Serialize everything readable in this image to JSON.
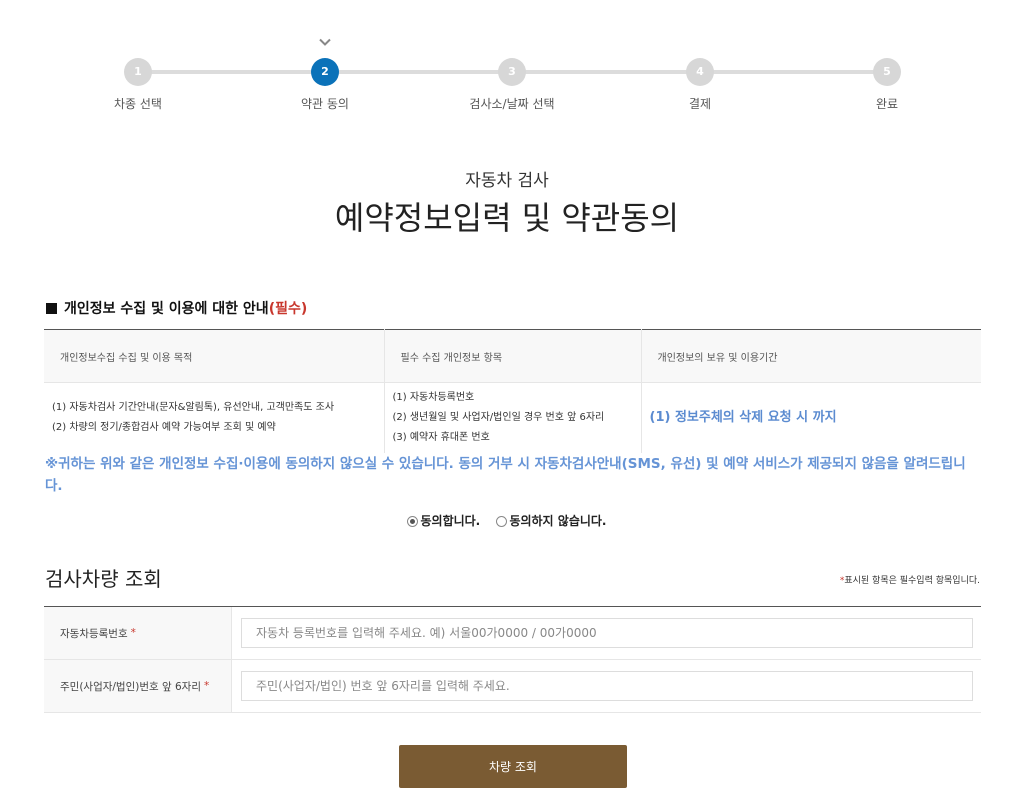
{
  "steps": [
    {
      "num": "1",
      "label": "차종 선택"
    },
    {
      "num": "2",
      "label": "약관 동의"
    },
    {
      "num": "3",
      "label": "검사소/날짜 선택"
    },
    {
      "num": "4",
      "label": "결제"
    },
    {
      "num": "5",
      "label": "완료"
    }
  ],
  "active_step": "2",
  "header": {
    "subtitle": "자동차 검사",
    "title": "예약정보입력 및 약관동의"
  },
  "privacy": {
    "heading": "개인정보 수집 및 이용에 대한 안내",
    "required": "(필수)",
    "columns": [
      "개인정보수집 수집 및 이용 목적",
      "필수 수집 개인정보 항목",
      "개인정보의 보유 및 이용기간"
    ],
    "purposes": [
      "(1) 자동차검사 기간안내(문자&알림톡), 유선안내, 고객만족도 조사",
      "(2) 차량의 정기/종합검사 예약 가능여부 조회 및 예약"
    ],
    "items": [
      "(1) 자동차등록번호",
      "(2) 생년월일 및 사업자/법인일 경우 번호 앞 6자리",
      "(3) 예약자 휴대폰 번호"
    ],
    "retention": "(1) 정보주체의 삭제 요청 시 까지",
    "notice": "※귀하는 위와 같은 개인정보 수집·이용에 동의하지 않으실 수 있습니다. 동의 거부 시 자동차검사안내(SMS, 유선) 및 예약 서비스가 제공되지 않음을 알려드립니다.",
    "agree_label": "동의합니다.",
    "disagree_label": "동의하지 않습니다.",
    "selected": "agree"
  },
  "lookup": {
    "title": "검사차량 조회",
    "required_note_star": "*",
    "required_note": "표시된 항목은 필수입력 항목입니다.",
    "fields": [
      {
        "label": "자동차등록번호",
        "placeholder": "자동차 등록번호를 입력해 주세요. 예) 서울00가0000 / 00가0000"
      },
      {
        "label": "주민(사업자/법인)번호 앞 6자리",
        "placeholder": "주민(사업자/법인) 번호 앞 6자리를 입력해 주세요."
      }
    ],
    "star": "*",
    "submit_label": "차량 조회"
  },
  "colors": {
    "active_step": "#0b72b9",
    "required_red": "#c8372d",
    "notice_blue": "#6694d6",
    "submit_brown": "#7a5b33"
  }
}
